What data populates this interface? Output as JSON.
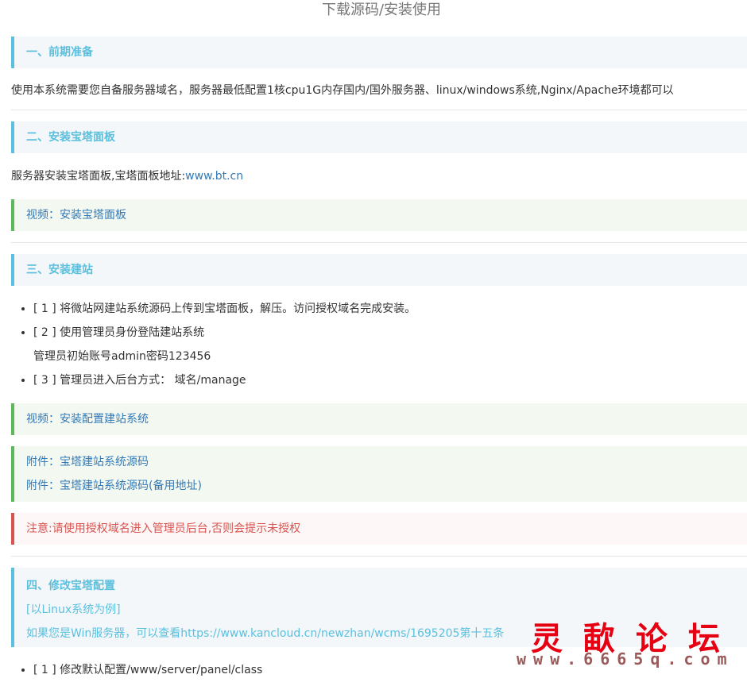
{
  "page_title": "下载源码/安装使用",
  "section1": {
    "title": "一、前期准备",
    "text": "使用本系统需要您自备服务器域名，服务器最低配置1核cpu1G内存国内/国外服务器、linux/windows系统,Nginx/Apache环境都可以"
  },
  "section2": {
    "title": "二、安装宝塔面板",
    "text_prefix": "服务器安装宝塔面板,宝塔面板地址:",
    "link": "www.bt.cn",
    "video": "视频：安装宝塔面板"
  },
  "section3": {
    "title": "三、安装建站",
    "steps": [
      "[ 1 ] 将微站网建站系统源码上传到宝塔面板，解压。访问授权域名完成安装。",
      "[ 2 ] 使用管理员身份登陆建站系统",
      "[ 3 ] 管理员进入后台方式： 域名/manage"
    ],
    "step2_sub": "管理员初始账号admin密码123456",
    "video": "视频：安装配置建站系统",
    "attachments": [
      "附件：宝塔建站系统源码",
      "附件：宝塔建站系统源码(备用地址)"
    ],
    "notice": "注意:请使用授权域名进入管理员后台,否则会提示未授权"
  },
  "section4": {
    "title": "四、修改宝塔配置",
    "subtitle": "[以Linux系统为例]",
    "win_note": "如果您是Win服务器，可以查看https://www.kancloud.cn/newzhan/wcms/1695205第十五条",
    "steps": [
      "[ 1 ] 修改默认配置/www/server/panel/class"
    ]
  },
  "watermark": {
    "title": "灵歃论坛",
    "url": "www.6665q.com"
  }
}
